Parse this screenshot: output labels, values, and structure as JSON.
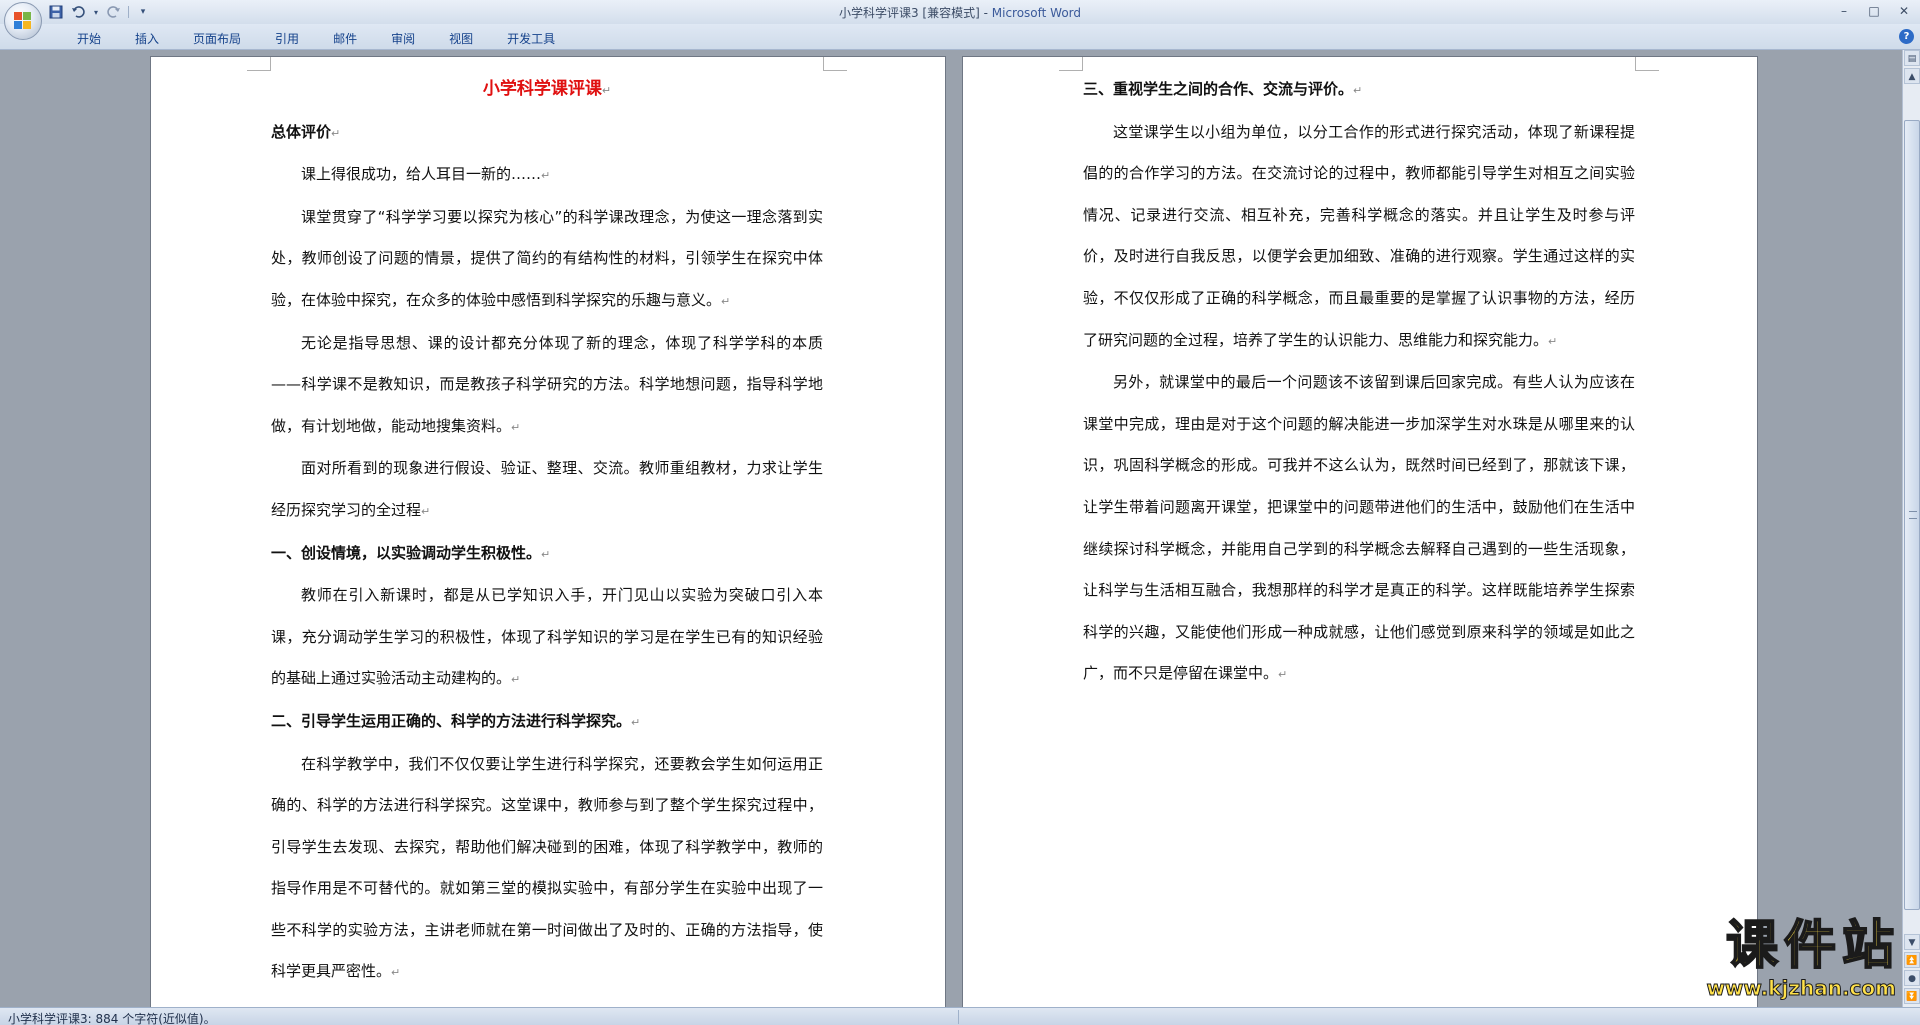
{
  "window": {
    "title_doc": "小学科学评课3 [兼容模式]",
    "title_sep": " - ",
    "title_app": "Microsoft Word",
    "minimize": "–",
    "maximize": "□",
    "close": "✕"
  },
  "quick_access": {
    "save_icon": "save-icon",
    "undo_icon": "undo-icon",
    "redo_icon": "redo-icon",
    "customize_icon": "customize-icon"
  },
  "ribbon": {
    "tabs": [
      "开始",
      "插入",
      "页面布局",
      "引用",
      "邮件",
      "审阅",
      "视图",
      "开发工具"
    ],
    "help": "?"
  },
  "document": {
    "left_page": {
      "title": "小学科学课评课",
      "blocks": [
        {
          "type": "h",
          "text": "总体评价"
        },
        {
          "type": "p",
          "text": "课上得很成功，给人耳目一新的……"
        },
        {
          "type": "p",
          "text": "课堂贯穿了“科学学习要以探究为核心”的科学课改理念，为使这一理念落到实处，教师创设了问题的情景，提供了简约的有结构性的材料，引领学生在探究中体验，在体验中探究，在众多的体验中感悟到科学探究的乐趣与意义。"
        },
        {
          "type": "p",
          "text": "无论是指导思想、课的设计都充分体现了新的理念，体现了科学学科的本质——科学课不是教知识，而是教孩子科学研究的方法。科学地想问题，指导科学地做，有计划地做，能动地搜集资料。"
        },
        {
          "type": "p",
          "text": "面对所看到的现象进行假设、验证、整理、交流。教师重组教材，力求让学生经历探究学习的全过程"
        },
        {
          "type": "h",
          "text": "一、创设情境，以实验调动学生积极性。"
        },
        {
          "type": "p",
          "text": "教师在引入新课时，都是从已学知识入手，开门见山以实验为突破口引入本课，充分调动学生学习的积极性，体现了科学知识的学习是在学生已有的知识经验的基础上通过实验活动主动建构的。"
        },
        {
          "type": "h",
          "text": "二、引导学生运用正确的、科学的方法进行科学探究。"
        },
        {
          "type": "p",
          "text": "在科学教学中，我们不仅仅要让学生进行科学探究，还要教会学生如何运用正确的、科学的方法进行科学探究。这堂课中，教师参与到了整个学生探究过程中，引导学生去发现、去探究，帮助他们解决碰到的困难，体现了科学教学中，教师的指导作用是不可替代的。就如第三堂的模拟实验中，有部分学生在实验中出现了一些不科学的实验方法，主讲老师就在第一时间做出了及时的、正确的方法指导，使科学更具严密性。"
        }
      ]
    },
    "right_page": {
      "blocks": [
        {
          "type": "h",
          "text": "三、重视学生之间的合作、交流与评价。"
        },
        {
          "type": "p",
          "text": "这堂课学生以小组为单位，以分工合作的形式进行探究活动，体现了新课程提倡的的合作学习的方法。在交流讨论的过程中，教师都能引导学生对相互之间实验情况、记录进行交流、相互补充，完善科学概念的落实。并且让学生及时参与评价，及时进行自我反思，以便学会更加细致、准确的进行观察。学生通过这样的实验，不仅仅形成了正确的科学概念，而且最重要的是掌握了认识事物的方法，经历了研究问题的全过程，培养了学生的认识能力、思维能力和探究能力。"
        },
        {
          "type": "p",
          "text": "另外，就课堂中的最后一个问题该不该留到课后回家完成。有些人认为应该在课堂中完成，理由是对于这个问题的解决能进一步加深学生对水珠是从哪里来的认识，巩固科学概念的形成。可我并不这么认为，既然时间已经到了，那就该下课，让学生带着问题离开课堂，把课堂中的问题带进他们的生活中，鼓励他们在生活中继续探讨科学概念，并能用自己学到的科学概念去解释自己遇到的一些生活现象，让科学与生活相互融合，我想那样的科学才是真正的科学。这样既能培养学生探索科学的兴趣，又能使他们形成一种成就感，让他们感觉到原来科学的领域是如此之广，而不只是停留在课堂中。"
        }
      ]
    },
    "paragraph_mark": "↵"
  },
  "status_bar": {
    "text": "小学科学评课3: 884 个字符(近似值)。"
  },
  "watermark": {
    "big": "课件站",
    "url": "www.kjzhan.com"
  },
  "colors": {
    "title_red": "#e01010",
    "watermark_yellow": "#ffe14a",
    "tab_text": "#15428b"
  }
}
